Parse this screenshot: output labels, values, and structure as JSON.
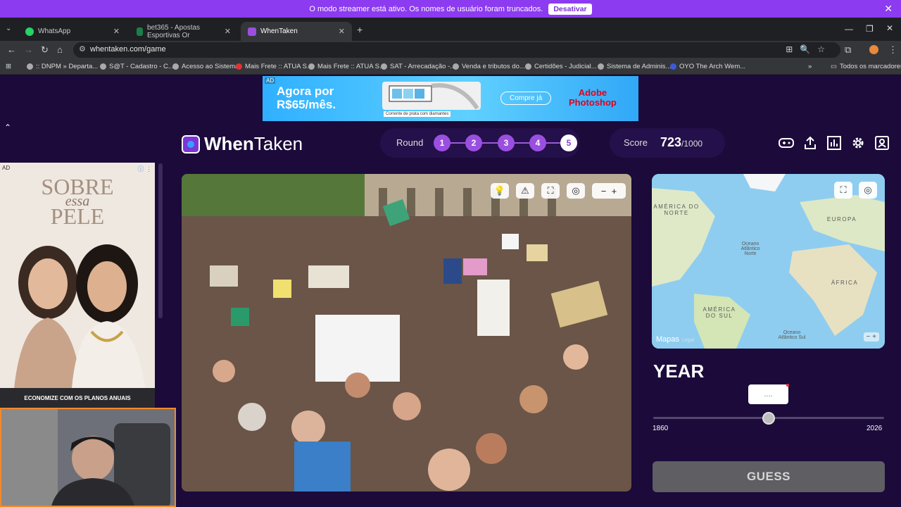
{
  "streamer": {
    "message": "O modo streamer está ativo. Os nomes de usuário foram truncados.",
    "button": "Desativar"
  },
  "tabs": [
    {
      "label": "WhatsApp"
    },
    {
      "label": "bet365 - Apostas Esportivas Or"
    },
    {
      "label": "WhenTaken"
    }
  ],
  "url": "whentaken.com/game",
  "bookmarks": [
    ":: DNPM » Departa...",
    "S@T - Cadastro - C...",
    "Acesso ao Sistema",
    "Mais Frete :: ATUA S...",
    "Mais Frete :: ATUA S...",
    "SAT - Arrecadação -...",
    "Venda e tributos do...",
    "Certidões - Judicial...",
    "Sistema de Adminis...",
    "OYO The Arch Wem...",
    "Todos os marcadores"
  ],
  "ad_top": {
    "label": "AD",
    "headline_1": "Agora por",
    "headline_2": "R$65/mês.",
    "caption": "Corrente de prata com diamantes",
    "cta": "Compre já",
    "brand_1": "Adobe",
    "brand_2": "Photoshop"
  },
  "header": {
    "logo_bold": "When",
    "logo_rest": "Taken",
    "round_label": "Round",
    "rounds": [
      "1",
      "2",
      "3",
      "4",
      "5"
    ],
    "current_round": 5,
    "score_label": "Score",
    "score_value": "723",
    "score_max": "/1000"
  },
  "ad_left": {
    "label": "AD",
    "title_1": "SOBRE",
    "title_mid": "essa",
    "title_2": "PELE",
    "footer": "ECONOMIZE COM OS PLANOS ANUAIS"
  },
  "map": {
    "labels": [
      "AMÉRICA DO NORTE",
      "Oceano Atlântico Norte",
      "EUROPA",
      "ÁFRICA",
      "AMÉRICA DO SUL",
      "Oceano Atlântico Sul"
    ],
    "brand": "Mapas",
    "legal": "Legal"
  },
  "year": {
    "label": "YEAR",
    "value": "....",
    "min": "1860",
    "max": "2026",
    "position_fraction": 0.5
  },
  "guess_label": "GUESS",
  "colors": {
    "accent": "#9b4fe0",
    "bg": "#1b0a3a",
    "streamer": "#8c3bf0"
  }
}
